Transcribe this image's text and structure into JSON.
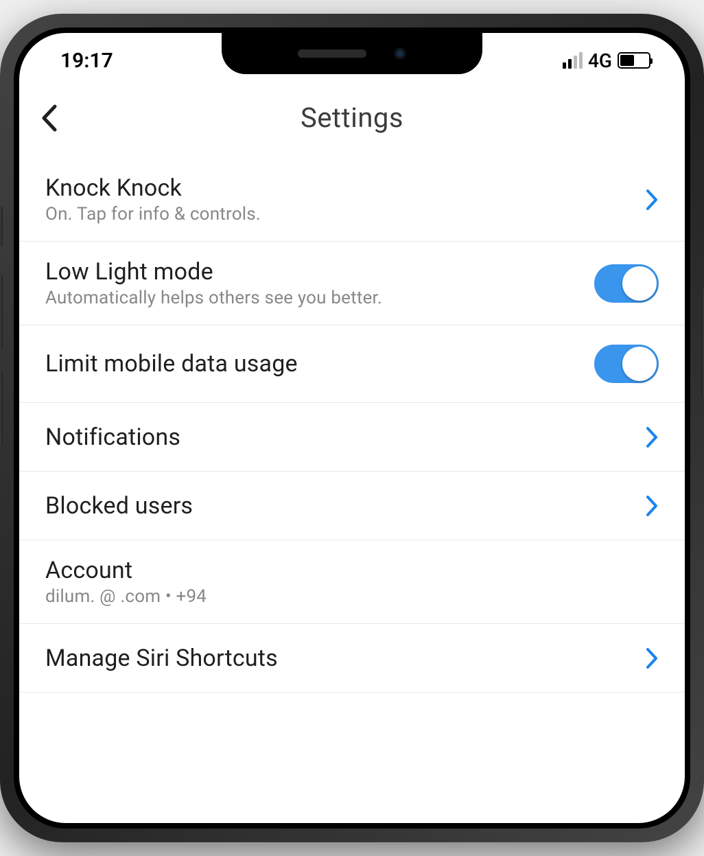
{
  "status_bar": {
    "time": "19:17",
    "network_type": "4G"
  },
  "header": {
    "title": "Settings"
  },
  "settings": {
    "items": [
      {
        "title": "Knock Knock",
        "subtitle": "On. Tap for info & controls.",
        "type": "link"
      },
      {
        "title": "Low Light mode",
        "subtitle": "Automatically helps others see you better.",
        "type": "toggle",
        "enabled": true
      },
      {
        "title": "Limit mobile data usage",
        "type": "toggle",
        "enabled": true
      },
      {
        "title": "Notifications",
        "type": "link"
      },
      {
        "title": "Blocked users",
        "type": "link"
      },
      {
        "title": "Account",
        "subtitle": "dilum.            @            .com • +94",
        "type": "plain"
      },
      {
        "title": "Manage Siri Shortcuts",
        "type": "link"
      }
    ]
  }
}
